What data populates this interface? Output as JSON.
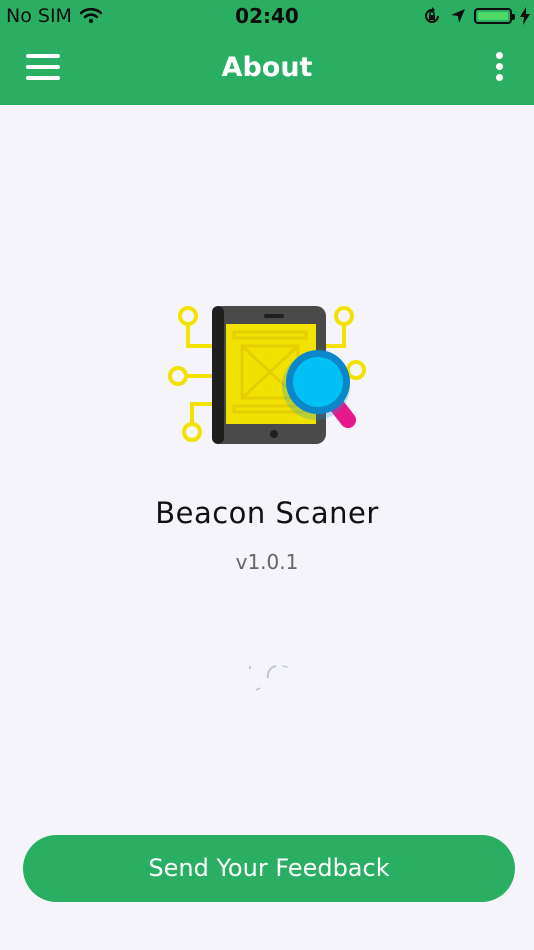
{
  "status_bar": {
    "carrier": "No SIM",
    "time": "02:40",
    "battery_level": 1.0
  },
  "navbar": {
    "title": "About",
    "menu_icon": "hamburger-menu-icon",
    "more_icon": "more-vertical-icon"
  },
  "app": {
    "icon": "beacon-scanner-tablet-icon",
    "name": "Beacon Scaner",
    "version": "v1.0.1"
  },
  "feedback_button": {
    "label": "Send Your Feedback"
  },
  "colors": {
    "primary": "#2aaf62",
    "background": "#f5f4fa",
    "accent_yellow": "#f2e200",
    "accent_cyan": "#00b8f0",
    "accent_pink": "#e7188c"
  }
}
